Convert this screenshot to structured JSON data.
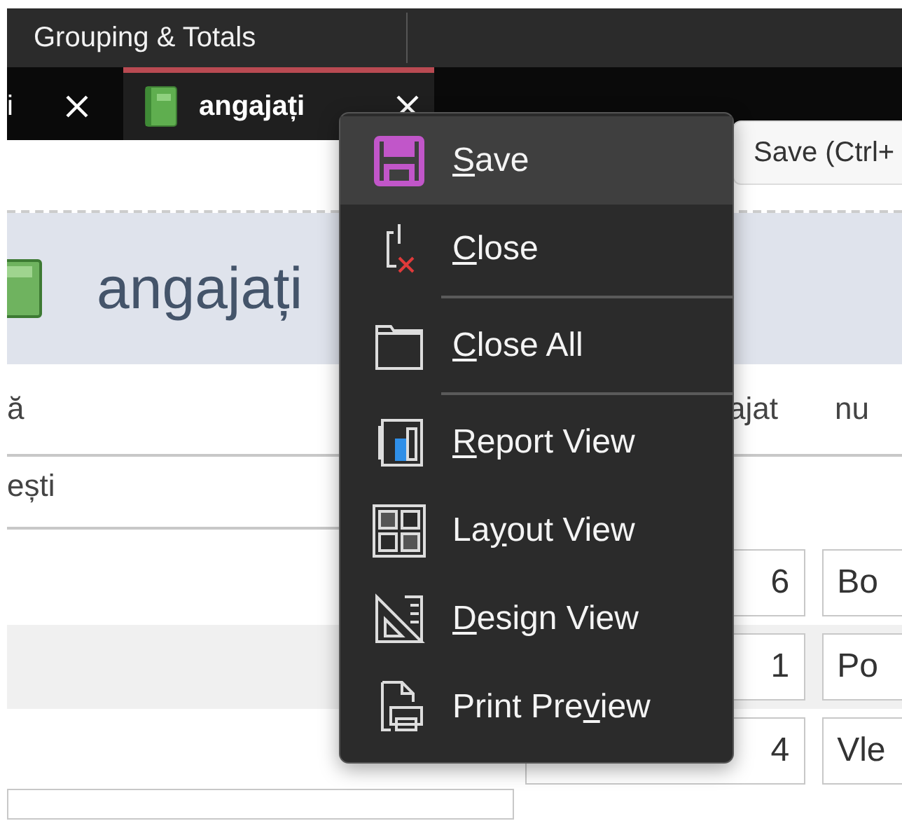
{
  "ribbon": {
    "group_label": "Grouping & Totals"
  },
  "document_tabs": [
    {
      "label": "i",
      "selected": false
    },
    {
      "label": "angajați",
      "selected": true
    }
  ],
  "report": {
    "title": "angajați",
    "column_headers": [
      "ă",
      "ajat",
      "nu"
    ],
    "group_value": "ești",
    "rows": [
      {
        "id": "6",
        "name": "Bo",
        "alternate": false
      },
      {
        "id": "1",
        "name": "Po",
        "alternate": true
      },
      {
        "id": "4",
        "name": "Vle",
        "alternate": false
      }
    ]
  },
  "context_menu": {
    "items": [
      {
        "kind": "save",
        "label_parts": {
          "key": "S",
          "after": "ave"
        },
        "highlighted": true,
        "separator_after": false
      },
      {
        "kind": "close",
        "label_parts": {
          "key": "C",
          "after": "lose"
        },
        "highlighted": false,
        "separator_after": true
      },
      {
        "kind": "close_all",
        "label_parts": {
          "key": "C",
          "after": "lose All"
        },
        "highlighted": false,
        "separator_after": true
      },
      {
        "kind": "report_view",
        "label_parts": {
          "key": "R",
          "after": "eport View"
        },
        "highlighted": false,
        "separator_after": false
      },
      {
        "kind": "layout_view",
        "label_parts": {
          "before": "La",
          "key": "y",
          "after": "out View"
        },
        "highlighted": false,
        "separator_after": false
      },
      {
        "kind": "design_view",
        "label_parts": {
          "key": "D",
          "after": "esign View"
        },
        "highlighted": false,
        "separator_after": false
      },
      {
        "kind": "print_preview",
        "label_parts": {
          "before": "Print Pre",
          "key": "v",
          "after": "iew"
        },
        "highlighted": false,
        "separator_after": false
      }
    ]
  },
  "tooltip": "Save (Ctrl+"
}
